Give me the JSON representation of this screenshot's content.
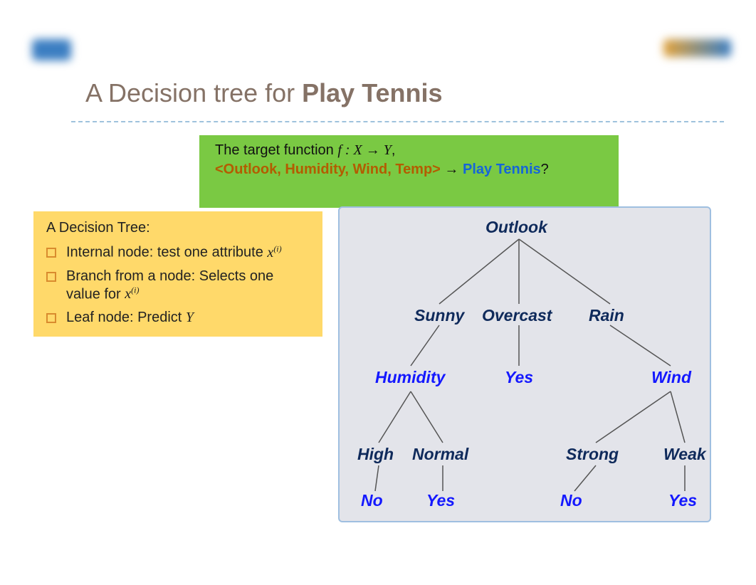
{
  "title_prefix": "A Decision tree for ",
  "title_bold": "Play Tennis",
  "green": {
    "line1_a": "The target function ",
    "line1_f": "f : X → Y",
    "line1_b": ",",
    "attrs": "<Outlook, Humidity, Wind, Temp>",
    "arrow": " → ",
    "play": "Play Tennis",
    "q": "?"
  },
  "yellow": {
    "heading": "A Decision Tree:",
    "item1_a": "Internal node: test one attribute ",
    "item1_m": "x",
    "item1_sup": "(i)",
    "item2_a": "Branch from a node: Selects one value for ",
    "item2_m": "x",
    "item2_sup": "(i)",
    "item3_a": "Leaf node: Predict ",
    "item3_m": "Y"
  },
  "tree": {
    "root": "Outlook",
    "b1": "Sunny",
    "b2": "Overcast",
    "b3": "Rain",
    "n_hum": "Humidity",
    "n_yes1": "Yes",
    "n_wind": "Wind",
    "b_high": "High",
    "b_norm": "Normal",
    "b_strong": "Strong",
    "b_weak": "Weak",
    "l_no1": "No",
    "l_yes2": "Yes",
    "l_no2": "No",
    "l_yes3": "Yes"
  }
}
